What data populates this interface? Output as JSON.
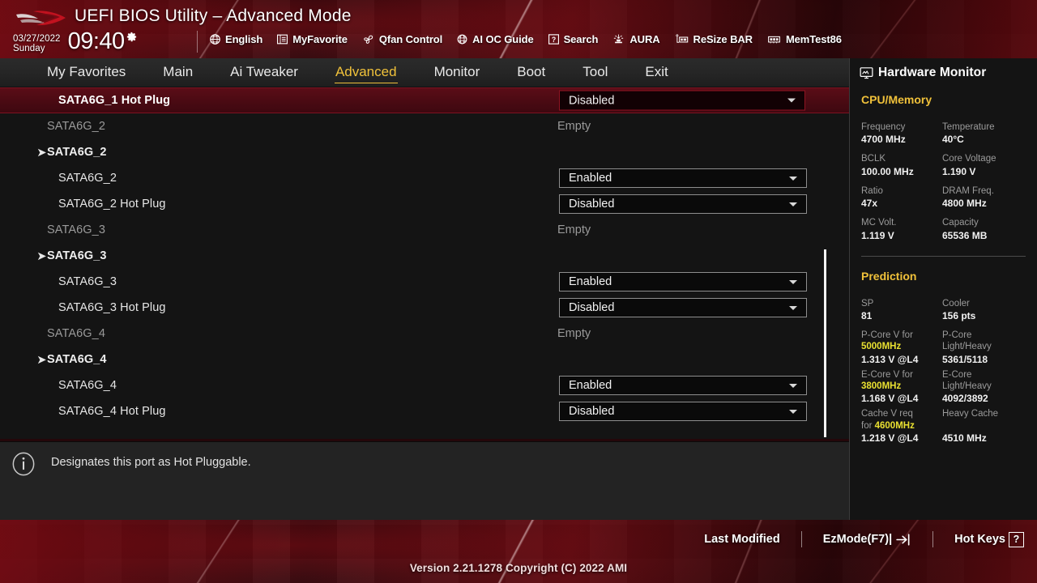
{
  "header": {
    "logo": "rog-logo",
    "title": "UEFI BIOS Utility – Advanced Mode",
    "date": "03/27/2022",
    "day": "Sunday",
    "time": "09:40",
    "gear_icon": "gear-icon",
    "tools": [
      {
        "icon": "globe-icon",
        "label": "English"
      },
      {
        "icon": "star-list-icon",
        "label": "MyFavorite"
      },
      {
        "icon": "fan-icon",
        "label": "Qfan Control"
      },
      {
        "icon": "ai-chip-icon",
        "label": "AI OC Guide"
      },
      {
        "icon": "question-icon",
        "label": "Search"
      },
      {
        "icon": "aura-icon",
        "label": "AURA"
      },
      {
        "icon": "resize-icon",
        "label": "ReSize BAR"
      },
      {
        "icon": "memory-icon",
        "label": "MemTest86"
      }
    ]
  },
  "nav": {
    "items": [
      {
        "label": "My Favorites",
        "active": false
      },
      {
        "label": "Main",
        "active": false
      },
      {
        "label": "Ai Tweaker",
        "active": false
      },
      {
        "label": "Advanced",
        "active": true
      },
      {
        "label": "Monitor",
        "active": false
      },
      {
        "label": "Boot",
        "active": false
      },
      {
        "label": "Tool",
        "active": false
      },
      {
        "label": "Exit",
        "active": false
      }
    ]
  },
  "content": {
    "rows": [
      {
        "label": "SATA6G_1 Hot Plug",
        "kind": "dropdown",
        "value": "Disabled",
        "indent": 2,
        "selected": true
      },
      {
        "label": "SATA6G_2",
        "kind": "text",
        "value": "Empty",
        "indent": 1,
        "selected": false,
        "muted": true
      },
      {
        "label": "SATA6G_2",
        "kind": "submenu",
        "value": "",
        "indent": 1,
        "selected": false
      },
      {
        "label": "SATA6G_2",
        "kind": "dropdown",
        "value": "Enabled",
        "indent": 2,
        "selected": false
      },
      {
        "label": "SATA6G_2 Hot Plug",
        "kind": "dropdown",
        "value": "Disabled",
        "indent": 2,
        "selected": false
      },
      {
        "label": "SATA6G_3",
        "kind": "text",
        "value": "Empty",
        "indent": 1,
        "selected": false,
        "muted": true
      },
      {
        "label": "SATA6G_3",
        "kind": "submenu",
        "value": "",
        "indent": 1,
        "selected": false
      },
      {
        "label": "SATA6G_3",
        "kind": "dropdown",
        "value": "Enabled",
        "indent": 2,
        "selected": false
      },
      {
        "label": "SATA6G_3 Hot Plug",
        "kind": "dropdown",
        "value": "Disabled",
        "indent": 2,
        "selected": false
      },
      {
        "label": "SATA6G_4",
        "kind": "text",
        "value": "Empty",
        "indent": 1,
        "selected": false,
        "muted": true
      },
      {
        "label": "SATA6G_4",
        "kind": "submenu",
        "value": "",
        "indent": 1,
        "selected": false
      },
      {
        "label": "SATA6G_4",
        "kind": "dropdown",
        "value": "Enabled",
        "indent": 2,
        "selected": false
      },
      {
        "label": "SATA6G_4 Hot Plug",
        "kind": "dropdown",
        "value": "Disabled",
        "indent": 2,
        "selected": false
      }
    ]
  },
  "help": {
    "icon": "info-icon",
    "text": "Designates this port as Hot Pluggable."
  },
  "hardware_monitor": {
    "icon": "monitor-icon",
    "title": "Hardware Monitor",
    "sections": [
      {
        "name": "CPU/Memory",
        "pairs": [
          {
            "k1": "Frequency",
            "v1": "4700 MHz",
            "k2": "Temperature",
            "v2": "40°C"
          },
          {
            "k1": "BCLK",
            "v1": "100.00 MHz",
            "k2": "Core Voltage",
            "v2": "1.190 V"
          },
          {
            "k1": "Ratio",
            "v1": "47x",
            "k2": "DRAM Freq.",
            "v2": "4800 MHz"
          },
          {
            "k1": "MC Volt.",
            "v1": "1.119 V",
            "k2": "Capacity",
            "v2": "65536 MB"
          }
        ]
      }
    ],
    "prediction": {
      "name": "Prediction",
      "sp_key": "SP",
      "sp_value": "81",
      "cooler_key": "Cooler",
      "cooler_value": "156 pts",
      "pcore_key_a": "P-Core V for",
      "pcore_key_hl": "5000MHz",
      "pcore_value": "1.313 V @L4",
      "pcore_lh_key": "P-Core",
      "pcore_lh_key2": "Light/Heavy",
      "pcore_lh_value": "5361/5118",
      "ecore_key_a": "E-Core V for",
      "ecore_key_hl": "3800MHz",
      "ecore_value": "1.168 V @L4",
      "ecore_lh_key": "E-Core",
      "ecore_lh_key2": "Light/Heavy",
      "ecore_lh_value": "4092/3892",
      "cache_key_a": "Cache V req",
      "cache_key_b": "for ",
      "cache_key_hl": "4600MHz",
      "cache_value": "1.218 V @L4",
      "heavy_cache_key": "Heavy Cache",
      "heavy_cache_value": "4510 MHz"
    }
  },
  "footer": {
    "last_modified": "Last Modified",
    "ez_mode": "EzMode(F7)|",
    "ez_mode_icon": "arrow-into-box-icon",
    "hot_keys": "Hot Keys",
    "hot_keys_badge": "?",
    "version": "Version 2.21.1278 Copyright (C) 2022 AMI"
  },
  "colors": {
    "accent_gold": "#f0c13a",
    "highlight_yellow": "#eae131",
    "selected_row_red": "#5b0d17",
    "panel_bg": "#141414",
    "help_bg": "#232323"
  }
}
